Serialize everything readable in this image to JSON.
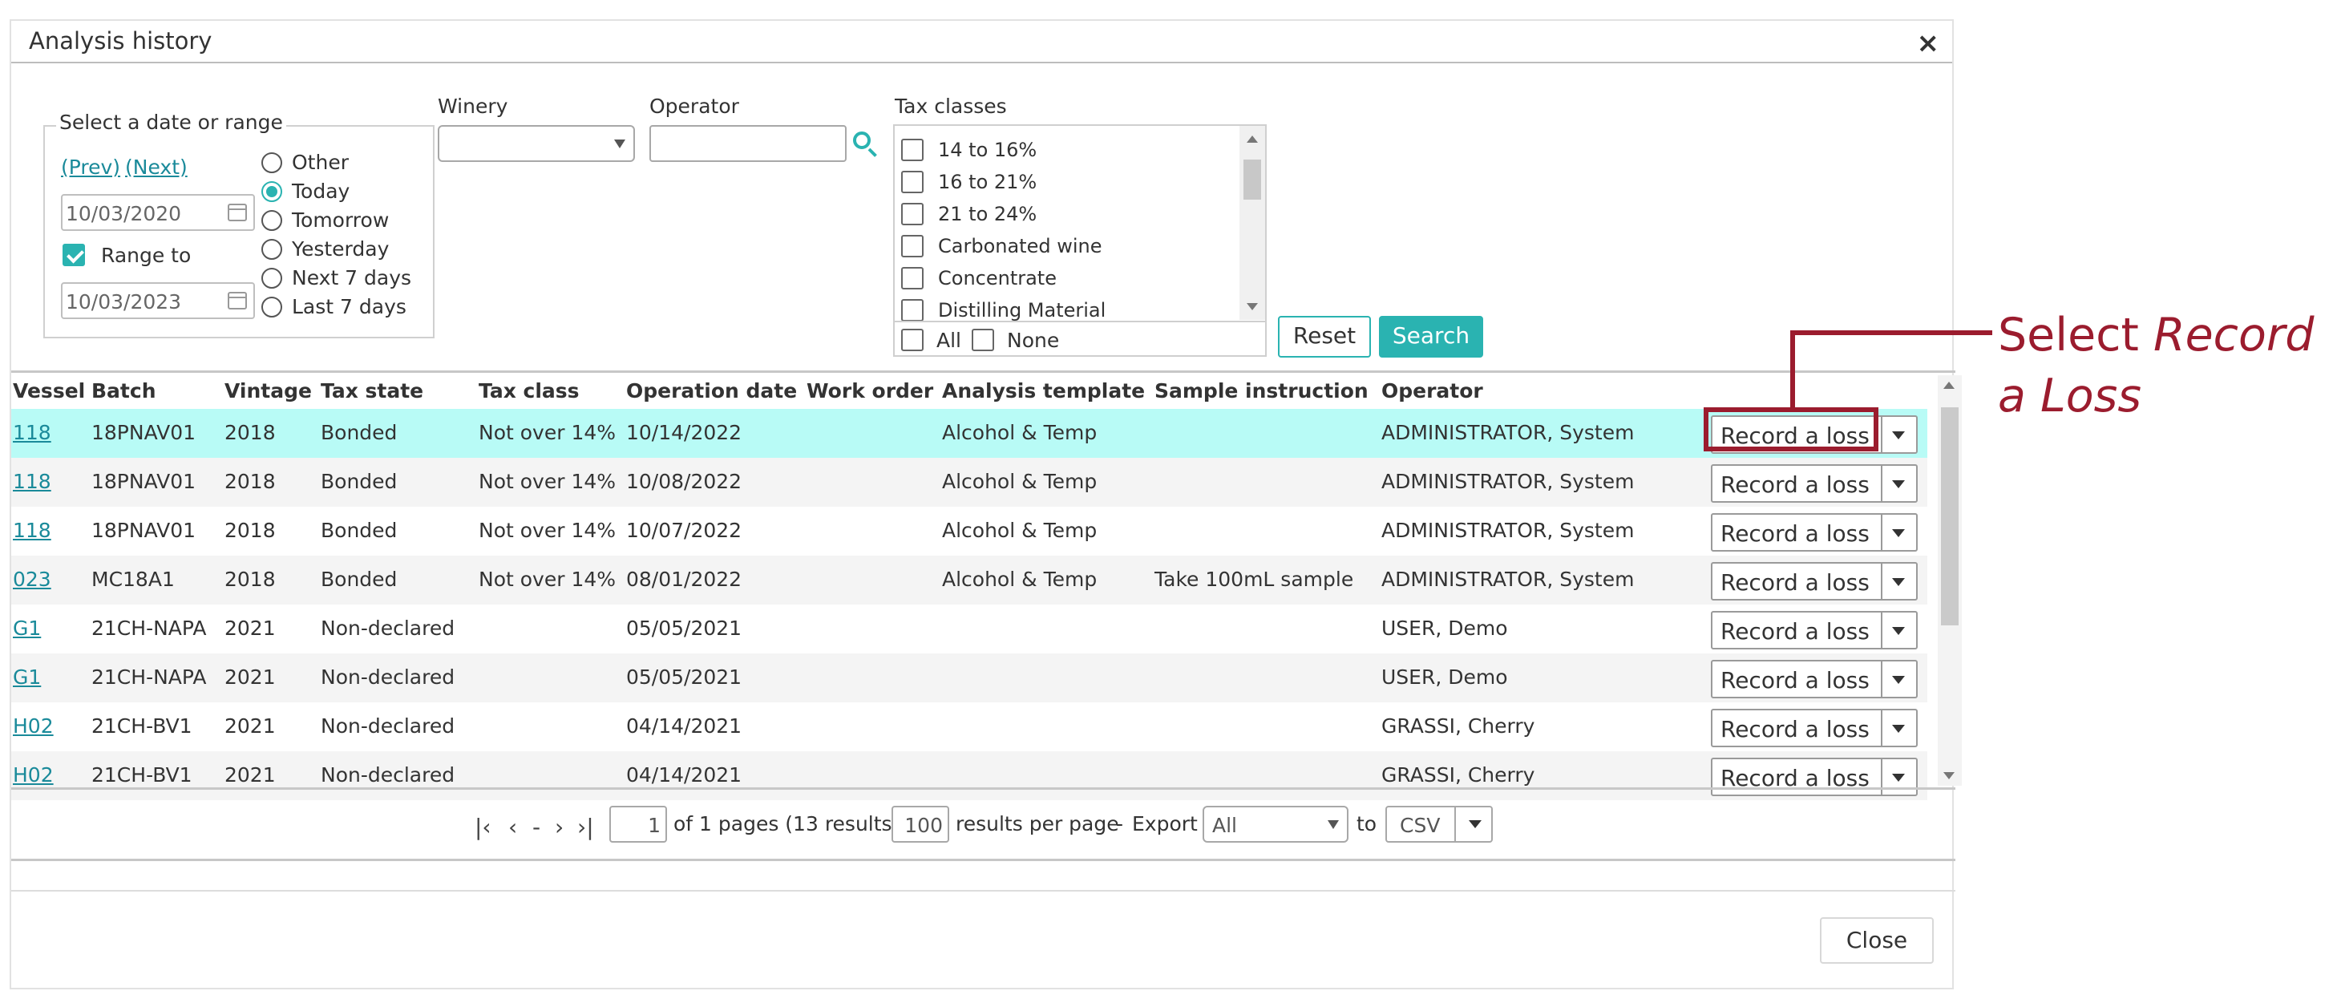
{
  "dialog": {
    "title": "Analysis history",
    "close_icon": "×"
  },
  "filters": {
    "date_group_label": "Select a date or range",
    "prev_link": "(Prev)",
    "next_link": "(Next)",
    "date_from": "10/03/2020",
    "range_to_label": "Range to",
    "range_to_checked": true,
    "date_to": "10/03/2023",
    "radio_options": [
      "Other",
      "Today",
      "Tomorrow",
      "Yesterday",
      "Next 7 days",
      "Last 7 days"
    ],
    "radio_selected": "Today",
    "winery_label": "Winery",
    "winery_value": "",
    "operator_label": "Operator",
    "operator_value": "",
    "tax_classes_label": "Tax classes",
    "tax_classes": [
      "14 to 16%",
      "16 to 21%",
      "21 to 24%",
      "Carbonated wine",
      "Concentrate",
      "Distilling Material"
    ],
    "all_label": "All",
    "none_label": "None",
    "reset_label": "Reset",
    "search_label": "Search"
  },
  "grid": {
    "columns": [
      "Vessel",
      "Batch",
      "Vintage",
      "Tax state",
      "Tax class",
      "Operation date",
      "Work order",
      "Analysis template",
      "Sample instruction",
      "Operator"
    ],
    "action_label": "Record a loss",
    "rows": [
      {
        "vessel": "118",
        "batch": "18PNAV01",
        "vintage": "2018",
        "tax_state": "Bonded",
        "tax_class": "Not over 14%",
        "operation_date": "10/14/2022",
        "work_order": "",
        "analysis_template": "Alcohol & Temp",
        "sample_instruction": "",
        "operator": "ADMINISTRATOR, System"
      },
      {
        "vessel": "118",
        "batch": "18PNAV01",
        "vintage": "2018",
        "tax_state": "Bonded",
        "tax_class": "Not over 14%",
        "operation_date": "10/08/2022",
        "work_order": "",
        "analysis_template": "Alcohol & Temp",
        "sample_instruction": "",
        "operator": "ADMINISTRATOR, System"
      },
      {
        "vessel": "118",
        "batch": "18PNAV01",
        "vintage": "2018",
        "tax_state": "Bonded",
        "tax_class": "Not over 14%",
        "operation_date": "10/07/2022",
        "work_order": "",
        "analysis_template": "Alcohol & Temp",
        "sample_instruction": "",
        "operator": "ADMINISTRATOR, System"
      },
      {
        "vessel": "023",
        "batch": "MC18A1",
        "vintage": "2018",
        "tax_state": "Bonded",
        "tax_class": "Not over 14%",
        "operation_date": "08/01/2022",
        "work_order": "",
        "analysis_template": "Alcohol & Temp",
        "sample_instruction": "Take 100mL sample",
        "operator": "ADMINISTRATOR, System"
      },
      {
        "vessel": "G1",
        "batch": "21CH-NAPA",
        "vintage": "2021",
        "tax_state": "Non-declared",
        "tax_class": "",
        "operation_date": "05/05/2021",
        "work_order": "",
        "analysis_template": "",
        "sample_instruction": "",
        "operator": "USER, Demo"
      },
      {
        "vessel": "G1",
        "batch": "21CH-NAPA",
        "vintage": "2021",
        "tax_state": "Non-declared",
        "tax_class": "",
        "operation_date": "05/05/2021",
        "work_order": "",
        "analysis_template": "",
        "sample_instruction": "",
        "operator": "USER, Demo"
      },
      {
        "vessel": "H02",
        "batch": "21CH-BV1",
        "vintage": "2021",
        "tax_state": "Non-declared",
        "tax_class": "",
        "operation_date": "04/14/2021",
        "work_order": "",
        "analysis_template": "",
        "sample_instruction": "",
        "operator": "GRASSI, Cherry"
      },
      {
        "vessel": "H02",
        "batch": "21CH-BV1",
        "vintage": "2021",
        "tax_state": "Non-declared",
        "tax_class": "",
        "operation_date": "04/14/2021",
        "work_order": "",
        "analysis_template": "",
        "sample_instruction": "",
        "operator": "GRASSI, Cherry"
      }
    ]
  },
  "pager": {
    "page": "1",
    "pages_text": "of 1 pages (13 results).",
    "per_page": "100",
    "per_page_text": "results per page",
    "dash": "-",
    "export_label": "Export",
    "export_scope": "All",
    "to_label": "to",
    "export_format": "CSV",
    "nav_first": "|‹",
    "nav_prev": "‹",
    "nav_next": "›",
    "nav_last": "›|"
  },
  "footer": {
    "close_label": "Close"
  },
  "annotation": {
    "text_plain": "Select ",
    "text_em1": "Record",
    "text_em2": "a Loss",
    "color": "#9b1c2e"
  },
  "colors": {
    "accent": "#2ab3b1",
    "link": "#1a8a9a",
    "selected_row": "#b8fbf6"
  }
}
